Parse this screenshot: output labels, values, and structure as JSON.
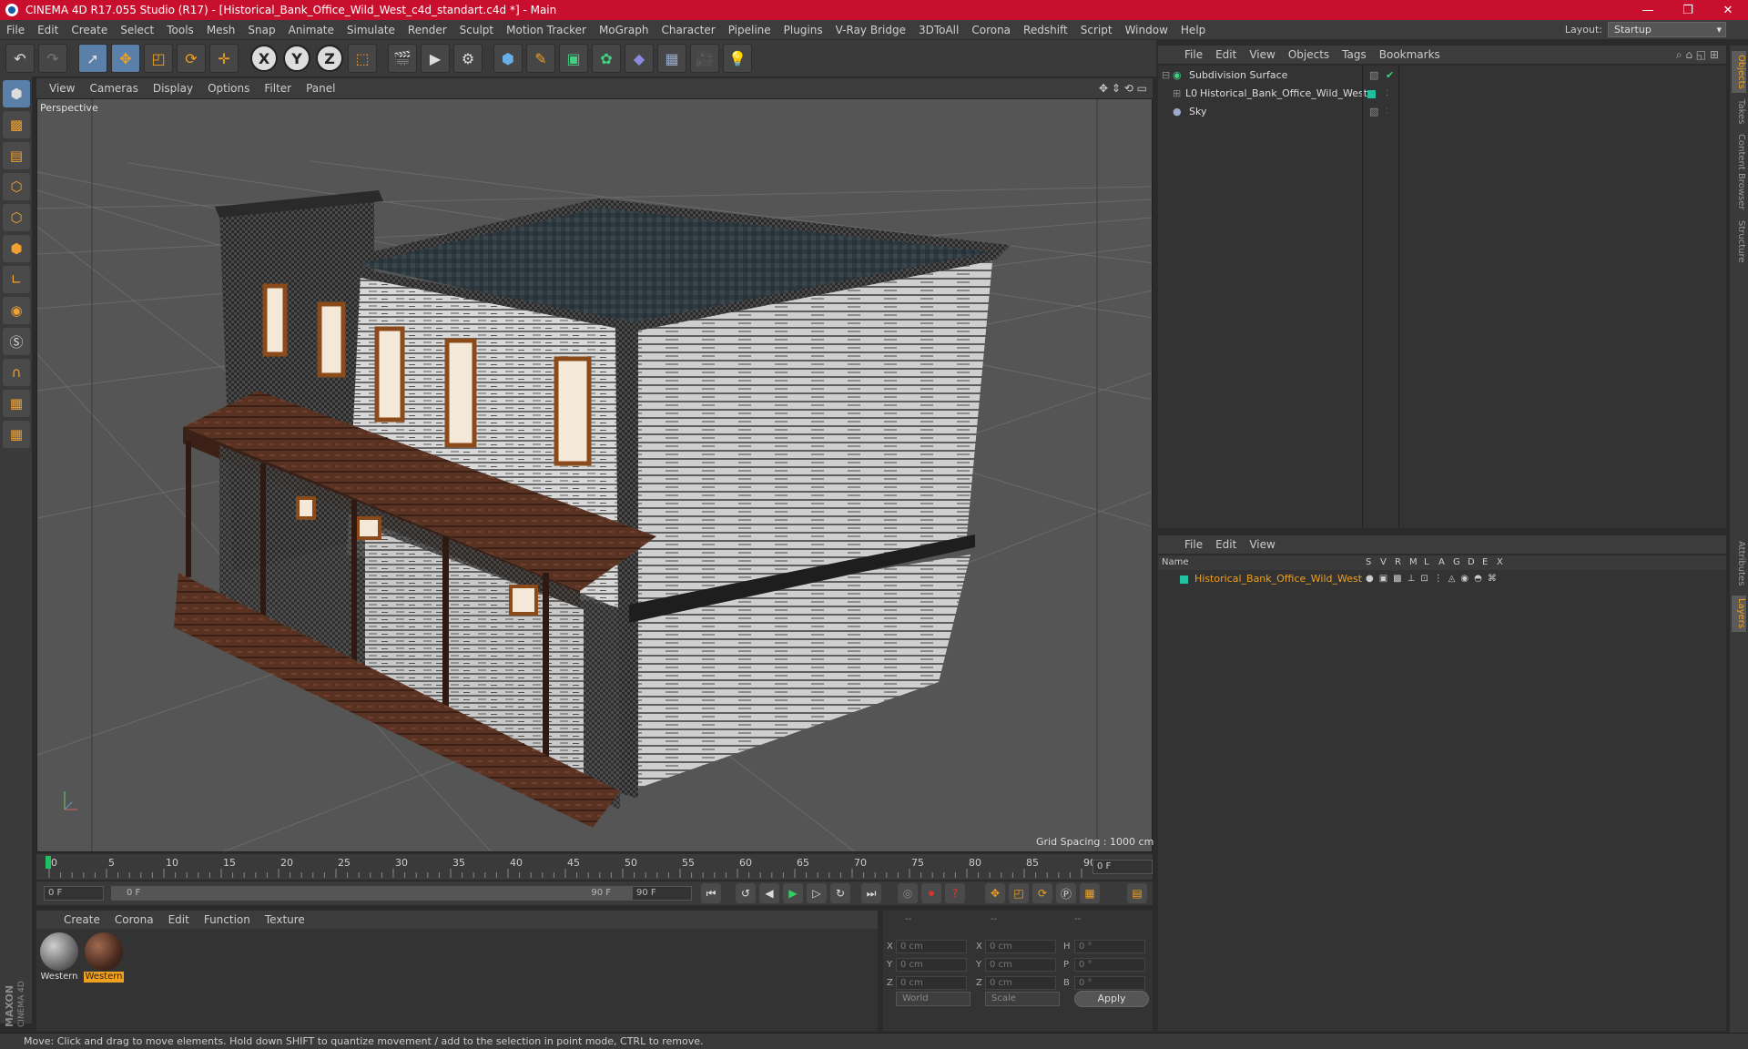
{
  "window": {
    "title": "CINEMA 4D R17.055 Studio (R17) - [Historical_Bank_Office_Wild_West_c4d_standart.c4d *] - Main",
    "minimize": "—",
    "restore": "❐",
    "close": "✕"
  },
  "menu": [
    "File",
    "Edit",
    "Create",
    "Select",
    "Tools",
    "Mesh",
    "Snap",
    "Animate",
    "Simulate",
    "Render",
    "Sculpt",
    "Motion Tracker",
    "MoGraph",
    "Character",
    "Pipeline",
    "Plugins",
    "V-Ray Bridge",
    "3DToAll",
    "Corona",
    "Redshift",
    "Script",
    "Window",
    "Help"
  ],
  "layout": {
    "label": "Layout:",
    "value": "Startup"
  },
  "toolbar": {
    "icons": [
      "undo-icon",
      "redo-icon",
      "select-icon",
      "move-icon",
      "scale-icon",
      "rotate-icon",
      "transform-icon",
      "axis-x-icon",
      "axis-y-icon",
      "axis-z-icon",
      "coordinate-system-icon",
      "render-view-icon",
      "render-picture-viewer-icon",
      "render-settings-icon",
      "cube-icon",
      "pen-spline-icon",
      "subdivision-icon",
      "cloner-icon",
      "deformer-icon",
      "floor-icon",
      "camera-icon",
      "light-icon"
    ],
    "axis_labels": [
      "X",
      "Y",
      "Z"
    ]
  },
  "left_tools": [
    "model-mode-icon",
    "texture-mode-icon",
    "workplane-icon",
    "points-mode-icon",
    "edges-mode-icon",
    "polygons-mode-icon",
    "axis-mode-icon",
    "tweak-icon",
    "solo-icon",
    "magnet-icon",
    "snap-lock-icon",
    "snap-settings-icon"
  ],
  "viewport": {
    "menu": [
      "View",
      "Cameras",
      "Display",
      "Options",
      "Filter",
      "Panel"
    ],
    "label": "Perspective",
    "grid_spacing": "Grid Spacing : 1000 cm"
  },
  "timeline": {
    "ticks": [
      "0",
      "5",
      "10",
      "15",
      "20",
      "25",
      "30",
      "35",
      "40",
      "45",
      "50",
      "55",
      "60",
      "65",
      "70",
      "75",
      "80",
      "85",
      "90"
    ],
    "current_frame": "0 F",
    "start_field": "0 F",
    "range_start": "0 F",
    "range_end": "90 F",
    "end_field": "90 F"
  },
  "materials": {
    "menu": [
      "Create",
      "Corona",
      "Edit",
      "Function",
      "Texture"
    ],
    "items": [
      {
        "label": "Western",
        "selected": false
      },
      {
        "label": "Western",
        "selected": true
      }
    ]
  },
  "coordinates": {
    "headers": [
      "--",
      "--",
      "--"
    ],
    "rows": [
      {
        "a": "X",
        "av": "0 cm",
        "b": "X",
        "bv": "0 cm",
        "c": "H",
        "cv": "0 °"
      },
      {
        "a": "Y",
        "av": "0 cm",
        "b": "Y",
        "bv": "0 cm",
        "c": "P",
        "cv": "0 °"
      },
      {
        "a": "Z",
        "av": "0 cm",
        "b": "Z",
        "bv": "0 cm",
        "c": "B",
        "cv": "0 °"
      }
    ],
    "mode": "World",
    "scale": "Scale",
    "apply": "Apply"
  },
  "status": "Move: Click and drag to move elements. Hold down SHIFT to quantize movement / add to the selection in point mode, CTRL to remove.",
  "objects": {
    "menu": [
      "File",
      "Edit",
      "View",
      "Objects",
      "Tags",
      "Bookmarks"
    ],
    "items": [
      {
        "name": "Subdivision Surface",
        "indent": 0
      },
      {
        "name": "Historical_Bank_Office_Wild_West",
        "indent": 1
      },
      {
        "name": "Sky",
        "indent": 0
      }
    ]
  },
  "layers": {
    "menu": [
      "File",
      "Edit",
      "View"
    ],
    "columns": [
      "Name",
      "S",
      "V",
      "R",
      "M",
      "L",
      "A",
      "G",
      "D",
      "E",
      "X"
    ],
    "row": "Historical_Bank_Office_Wild_West"
  },
  "right_tabs": [
    "Objects",
    "Takes",
    "Content Browser",
    "Structure",
    "Attributes",
    "Layers"
  ],
  "brand": {
    "maxon": "MAXON",
    "product": "CINEMA 4D"
  },
  "colors": {
    "titlebar": "#c8102e",
    "accent": "#f0a020",
    "layer": "#20c0a0"
  }
}
